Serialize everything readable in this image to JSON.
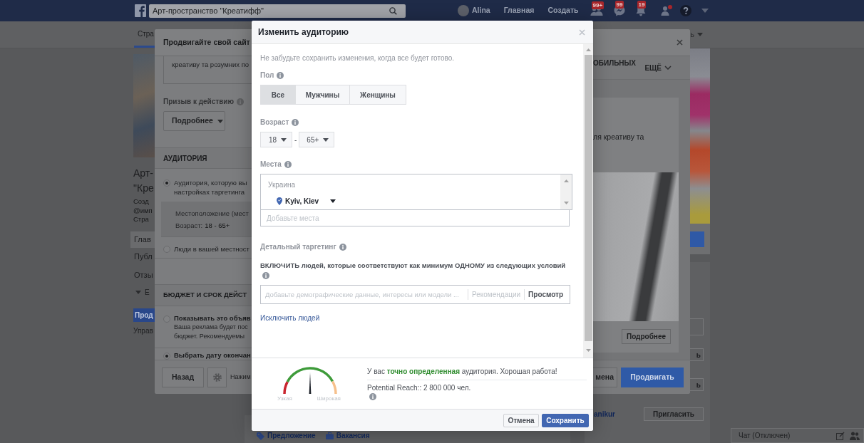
{
  "top_bar": {
    "search": {
      "value": "Арт-пространство \"Креатифф\""
    },
    "user_name": "Alina",
    "links": [
      "Главная",
      "Создать"
    ],
    "notifications": [
      {
        "kind": "friends",
        "count": "99+"
      },
      {
        "kind": "messages",
        "count": "99"
      },
      {
        "kind": "bell",
        "count": "19"
      }
    ]
  },
  "page": {
    "nav": {
      "tabs": [
        {
          "label": "Стра",
          "selected": true
        }
      ],
      "more_label": "ь"
    },
    "left_column": {
      "title_lines": [
        "Арт-",
        "\"Кре"
      ],
      "meta_lines": [
        "Созд",
        "@имп",
        "Стра"
      ],
      "menu": [
        {
          "label": "Глав",
          "selected": true
        },
        {
          "label": "Публ",
          "selected": false
        },
        {
          "label": "Отзы",
          "selected": false
        }
      ],
      "more_label": "Е",
      "promote_button": "Прод",
      "manage_link": "Управ"
    },
    "composer_actions": [
      {
        "kind": "offer",
        "label": "Предложение"
      },
      {
        "kind": "job",
        "label": "Вакансия"
      }
    ],
    "right_column": {
      "invite_fragments": [
        "ь",
        "ь"
      ],
      "profile_link": "anikur",
      "invite_button": "Пригласить"
    }
  },
  "promote_dialog": {
    "title": "Продвигайте свой сайт",
    "ad_text_line": "креативу та розумних по",
    "call_to_action": {
      "label": "Призыв к действию",
      "value": "Подробнее"
    },
    "audience": {
      "header": "АУДИТОРИЯ",
      "options": [
        {
          "lines": [
            "Аудитория, которую вы",
            "настройках таргетинга"
          ],
          "selected": true,
          "summary": {
            "location": "Местоположение (мест",
            "age_label": "Возраст:",
            "age_value": "18 - 65+"
          }
        },
        {
          "lines": [
            "Люди в вашей местност"
          ],
          "selected": false
        }
      ]
    },
    "budget": {
      "header": "БЮДЖЕТ И СРОК ДЕЙСТ",
      "options": [
        {
          "title": "Показывать это объяв",
          "lines": [
            "Ваша реклама будет пос",
            "бюджет. Рекомендуемы"
          ],
          "selected": false
        },
        {
          "title": "Выбрать дату окончан",
          "selected": true
        }
      ]
    },
    "placement_tab": "ОБИЛЬНЫХ",
    "more_tab": "ЕЩЁ",
    "preview": {
      "text_line": "ля креативу та",
      "button": "Подробнее"
    },
    "back_button": "Назад",
    "footer_hint": "Нажим",
    "cancel_button": "мена",
    "promote_button": "Продвигать"
  },
  "audience_dialog": {
    "title": "Изменить аудиторию",
    "note": "Не забудьте сохранить изменения, когда все будет готово.",
    "gender": {
      "label": "Пол",
      "options": [
        {
          "label": "Все",
          "selected": true
        },
        {
          "label": "Мужчины",
          "selected": false
        },
        {
          "label": "Женщины",
          "selected": false
        }
      ]
    },
    "age": {
      "label": "Возраст",
      "min": "18",
      "separator": "-",
      "max": "65+"
    },
    "locations": {
      "label": "Места",
      "country": "Украина",
      "items": [
        {
          "label": "Kyiv, Kiev"
        }
      ],
      "placeholder": "Добавьте места"
    },
    "detailed_targeting": {
      "label": "Детальный таргетинг",
      "include_label": "ВКЛЮЧИТЬ людей, которые соответствуют как минимум ОДНОМУ из следующих условий",
      "placeholder": "Добавьте демографические данные, интересы или модели ...",
      "suggestions": "Рекомендации",
      "browse": "Просмотр"
    },
    "exclude_link": "Исключить людей",
    "audience_size": {
      "narrow_label": "Узкая",
      "broad_label": "Широкая",
      "level": 0.5,
      "message": "У вас **точно определенная** аудитория. Хорошая работа!",
      "reach": "Potential Reach:: 2 800 000 чел."
    },
    "cancel_button": "Отмена",
    "save_button": "Сохранить"
  },
  "chat_bar": {
    "label": "Чат (Отключен)"
  }
}
